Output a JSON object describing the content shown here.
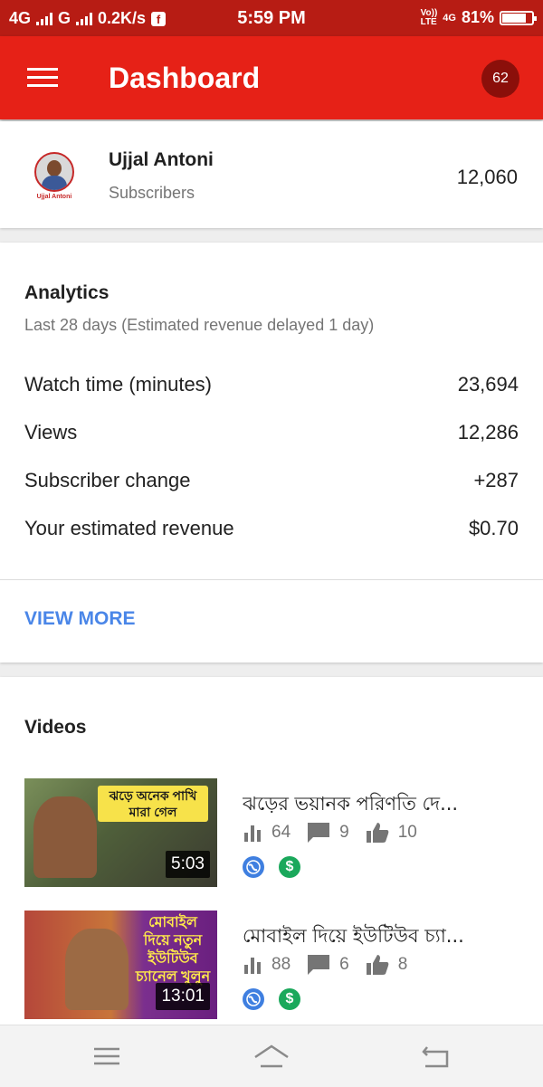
{
  "status_bar": {
    "network1": "4G",
    "network2": "G",
    "speed": "0.2K/s",
    "time": "5:59 PM",
    "volte_top": "Vo))",
    "volte_bottom": "LTE",
    "network3": "4G",
    "battery": "81%",
    "battery_level": 0.81
  },
  "appbar": {
    "title": "Dashboard",
    "notification_count": "62"
  },
  "channel": {
    "name": "Ujjal Antoni",
    "avatar_caption": "Ujjal Antoni",
    "subscribers_label": "Subscribers",
    "subscribers_count": "12,060"
  },
  "analytics": {
    "title": "Analytics",
    "subtitle": "Last 28 days (Estimated revenue delayed 1 day)",
    "metrics": [
      {
        "label": "Watch time (minutes)",
        "value": "23,694"
      },
      {
        "label": "Views",
        "value": "12,286"
      },
      {
        "label": "Subscriber change",
        "value": "+287"
      },
      {
        "label": "Your estimated revenue",
        "value": "$0.70"
      }
    ],
    "view_more": "VIEW MORE"
  },
  "videos": {
    "title": "Videos",
    "items": [
      {
        "title": "ঝড়ের ভয়ানক পরিণতি দে...",
        "thumbnail_text": "ঝড়ে অনেক পাখি মারা গেল",
        "duration": "5:03",
        "views": "64",
        "comments": "9",
        "likes": "10"
      },
      {
        "title": "মোবাইল দিয়ে ইউটিউব চ্যা...",
        "thumbnail_text": "মোবাইল দিয়ে নতুন ইউটিউব চ্যানেল খুলুন",
        "duration": "13:01",
        "views": "88",
        "comments": "6",
        "likes": "8"
      }
    ]
  },
  "colors": {
    "status_bar": "#b71c14",
    "app_bar": "#e62117",
    "link": "#4a86e8",
    "globe": "#3f7fe0",
    "monetized": "#1aa85b"
  },
  "icons": [
    "menu-icon",
    "facebook-icon",
    "battery-icon",
    "bar-chart-icon",
    "comment-icon",
    "thumbs-up-icon",
    "globe-icon",
    "dollar-icon",
    "recent-apps-icon",
    "home-icon",
    "back-icon"
  ]
}
